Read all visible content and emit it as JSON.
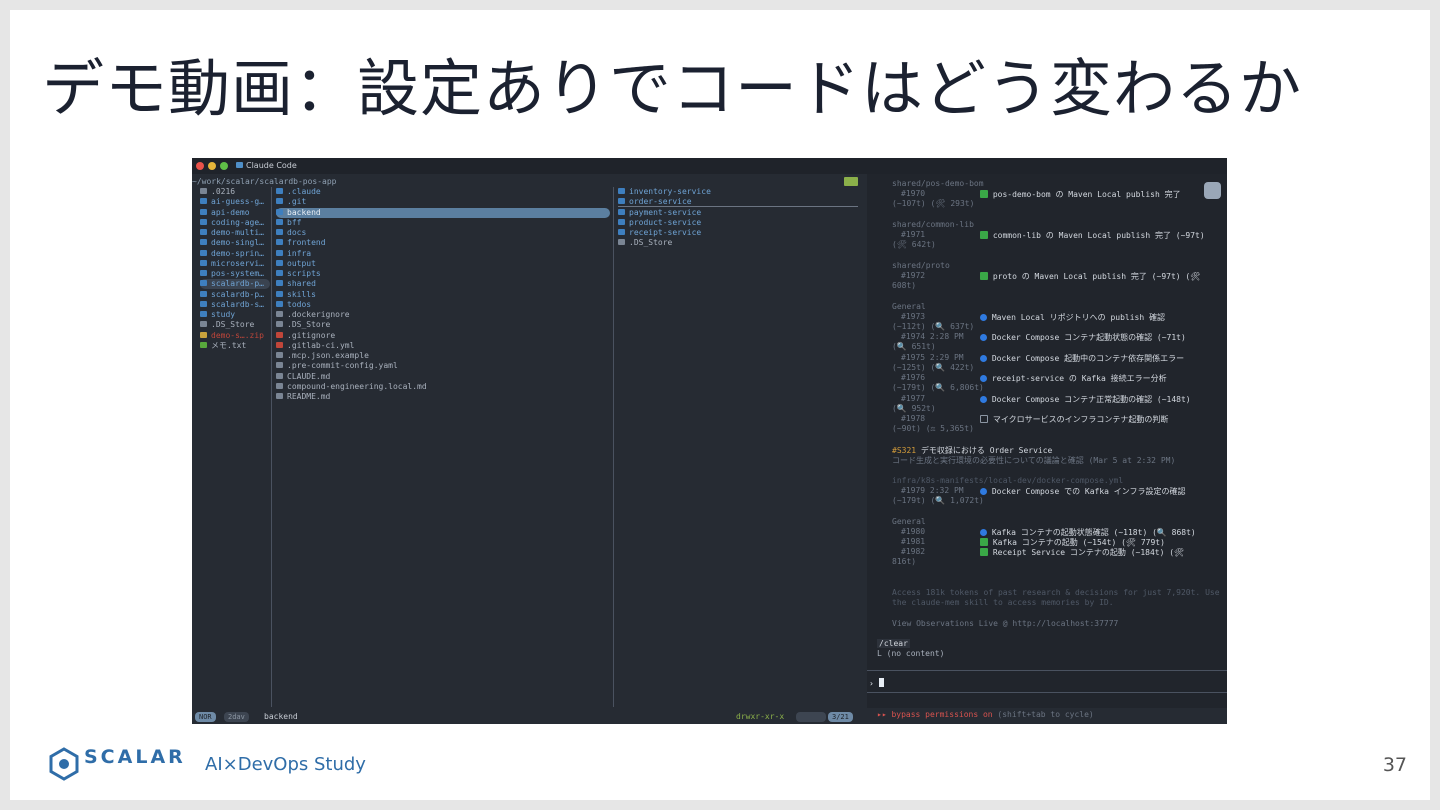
{
  "slide": {
    "title": "デモ動画：設定ありでコードはどう変わるか",
    "page_number": "37",
    "logo_text": "SCALAR",
    "event": "AI×DevOps Study"
  },
  "terminal": {
    "window_title": "Claude Code",
    "path": "~/work/scalar/scalardb-pos-app",
    "col1": [
      ".0216",
      "ai-guess-g…",
      "api-demo",
      "coding-age…",
      "demo-multi…",
      "demo-singl…",
      "demo-sprin…",
      "microservi…",
      "pos-system…",
      "scalardb-p…",
      "scalardb-p…",
      "scalardb-s…",
      "study",
      ".DS_Store",
      "demo-s….zip",
      "メモ.txt"
    ],
    "col2": [
      ".claude",
      ".git",
      "backend",
      "bff",
      "docs",
      "frontend",
      "infra",
      "output",
      "scripts",
      "shared",
      "skills",
      "todos",
      ".dockerignore",
      ".DS_Store",
      ".gitignore",
      ".gitlab-ci.yml",
      ".mcp.json.example",
      ".pre-commit-config.yaml",
      "CLAUDE.md",
      "compound-engineering.local.md",
      "README.md"
    ],
    "col3": [
      "inventory-service",
      "order-service",
      "payment-service",
      "product-service",
      "receipt-service",
      ".DS_Store"
    ],
    "status": {
      "mode": "NOR",
      "mode2": "2dav",
      "current": "backend",
      "perms": "drwxr-xr-x",
      "position": "3/21"
    },
    "log": {
      "g1": "shared/pos-demo-bom",
      "e1970_id": "#1970",
      "e1970_text": "pos-demo-bom の Maven Local publish 完了",
      "e1970_meta": "(~107t) (🛠 293t)",
      "g2": "shared/common-lib",
      "e1971_id": "#1971",
      "e1971_text": "common-lib の Maven Local publish 完了 (~97t)",
      "e1971_meta": "(🛠 642t)",
      "g3": "shared/proto",
      "e1972_id": "#1972",
      "e1972_text": "proto の Maven Local publish 完了 (~97t) (🛠",
      "e1972_meta": "608t)",
      "g4": "General",
      "e1973_id": "#1973",
      "e1973_text": "Maven Local リポジトリへの publish 確認",
      "e1973_meta": "(~112t) (🔍 637t)",
      "e1974_id": "#1974  2:28 PM",
      "e1974_text": "Docker Compose コンテナ起動状態の確認 (~71t)",
      "e1974_meta": "(🔍 651t)",
      "e1975_id": "#1975  2:29 PM",
      "e1975_text": "Docker Compose 起動中のコンテナ依存関係エラー",
      "e1975_meta": "(~125t) (🔍 422t)",
      "e1976_id": "#1976",
      "e1976_text": "receipt-service の Kafka 接続エラー分析",
      "e1976_meta": "(~179t) (🔍 6,806t)",
      "e1977_id": "#1977",
      "e1977_text": "Docker Compose コンテナ正常起動の確認 (~148t)",
      "e1977_meta": "(🔍 952t)",
      "e1978_id": "#1978",
      "e1978_text": "マイクロサービスのインフラコンテナ起動の判断",
      "e1978_meta": "(~90t) (⚖ 5,365t)",
      "session_id": "#S321",
      "session_title": "デモ収録における Order Service",
      "session_desc": "コード生成と実行環境の必要性についての議論と確認 (Mar 5 at 2:32 PM)",
      "g5": "infra/k8s-manifests/local-dev/docker-compose.yml",
      "e1979_id": "#1979  2:32 PM",
      "e1979_text": "Docker Compose での Kafka インフラ設定の確認",
      "e1979_meta": "(~179t) (🔍 1,072t)",
      "g6": "General",
      "e1980_id": "#1980",
      "e1980_text": "Kafka コンテナの起動状態確認 (~118t) (🔍 868t)",
      "e1981_id": "#1981",
      "e1981_text": "Kafka コンテナの起動 (~154t) (🛠 779t)",
      "e1982_id": "#1982",
      "e1982_text": "Receipt Service コンテナの起動 (~184t) (🛠",
      "e1982_meta": "816t)",
      "access1": "Access 181k tokens of past research & decisions for just 7,920t. Use",
      "access2": " the claude-mem skill to access memories by ID.",
      "view": "View Observations Live @ http://localhost:37777",
      "clear_cmd": "/clear",
      "clear_out": "L  (no content)",
      "prompt": "›",
      "bypass": "▸▸ bypass permissions on",
      "bypass_hint": "(shift+tab to cycle)"
    }
  },
  "colors": {
    "accent": "#2f6da8",
    "terminal_bg": "#262b33",
    "check": "#3aa847",
    "dot": "#2f7ae0"
  }
}
